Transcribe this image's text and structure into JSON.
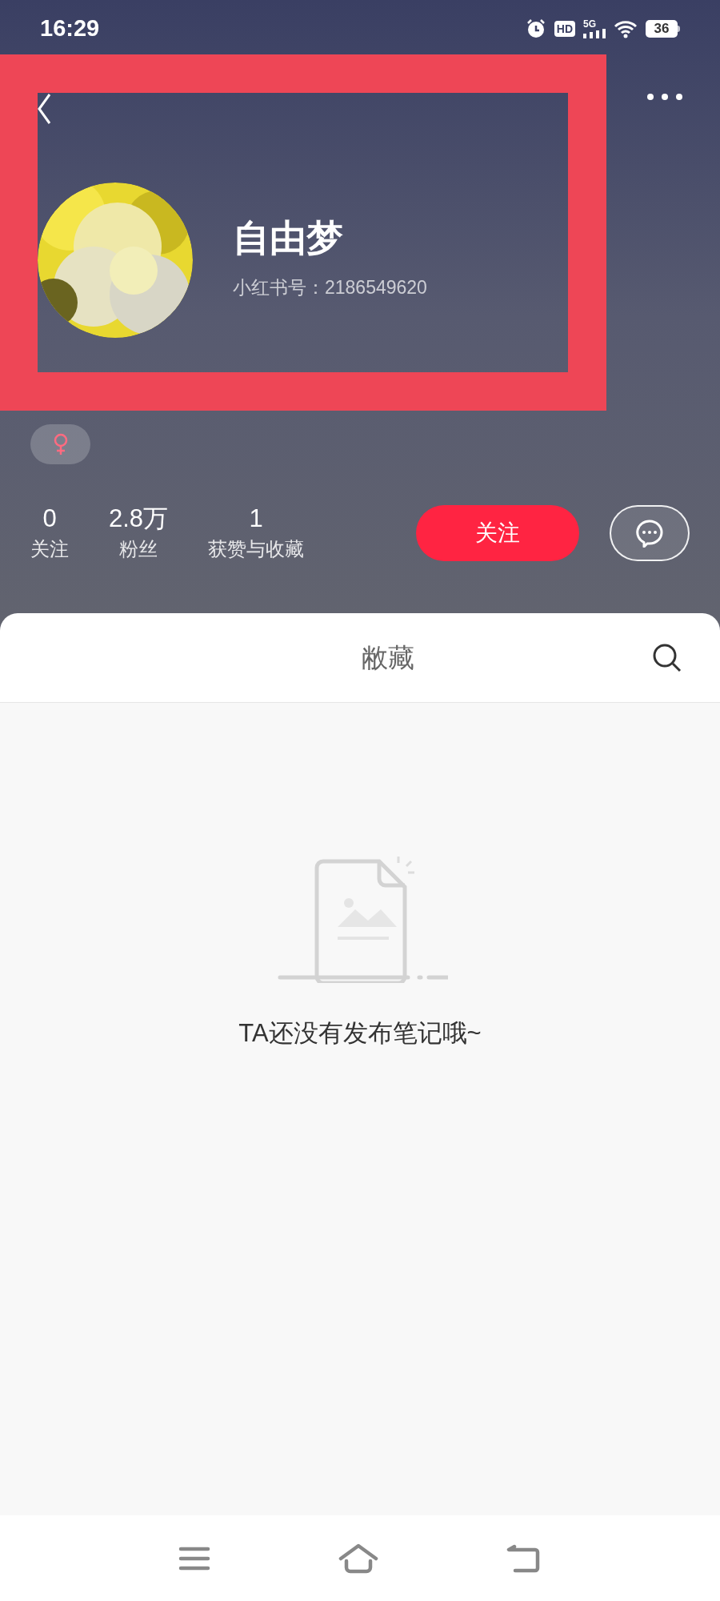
{
  "status_bar": {
    "time": "16:29",
    "hd": "HD",
    "network": "5G",
    "battery": "36"
  },
  "profile": {
    "name": "自由梦",
    "id_text": "小红书号：2186549620"
  },
  "stats": [
    {
      "value": "0",
      "label": "关注"
    },
    {
      "value": "2.8万",
      "label": "粉丝"
    },
    {
      "value": "1",
      "label": "获赞与收藏"
    }
  ],
  "follow_button": "关注",
  "tabs": [
    {
      "label": "敝藏"
    }
  ],
  "empty_state": {
    "message": "TA还没有发布笔记哦~"
  }
}
